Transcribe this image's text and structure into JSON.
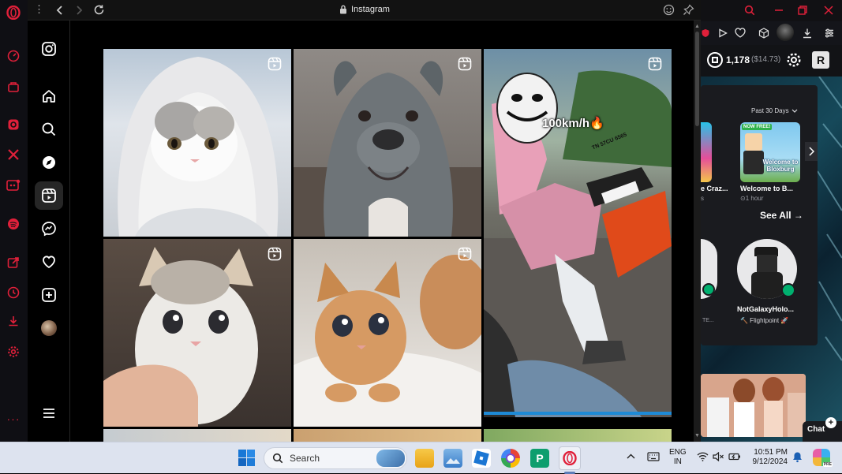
{
  "browser": {
    "url_title": "Instagram"
  },
  "instagram": {
    "nav_items": [
      "instagram-logo",
      "home",
      "search",
      "explore",
      "reels",
      "messages",
      "notifications",
      "create",
      "profile",
      "more"
    ]
  },
  "feed": {
    "tiles": [
      {
        "name": "reel-cat-hoodie"
      },
      {
        "name": "reel-pitbull"
      },
      {
        "name": "reel-motorbike",
        "caption": "100km/h🔥",
        "plate": "TN 57CU 6565"
      },
      {
        "name": "reel-kitten-fluffy"
      },
      {
        "name": "reel-kitten-orange"
      }
    ]
  },
  "roblox": {
    "robux_amount": "1,178",
    "robux_usd": "($14.73)",
    "filter_label": "Past 30 Days",
    "game_left_title": "e Craz...",
    "game_left_sub": "s",
    "game_right_title": "Welcome to B...",
    "game_right_badge": "NOW FREE!",
    "game_right_art": "Welcome to Bloxburg",
    "game_right_time": "⊙1 hour",
    "see_all": "See All →",
    "friend_left_sub": "TE...",
    "friend_name": "NotGalaxyHolo...",
    "friend_status": "🔨 Flightpoint 🚀",
    "chat_label": "Chat"
  },
  "taskbar": {
    "search_placeholder": "Search",
    "lang_line1": "ENG",
    "lang_line2": "IN",
    "time": "10:51 PM",
    "date": "9/12/2024"
  },
  "colors": {
    "opera_red": "#e0203a",
    "taskbar_bg": "#dde3ef",
    "ig_bg": "#000000"
  }
}
